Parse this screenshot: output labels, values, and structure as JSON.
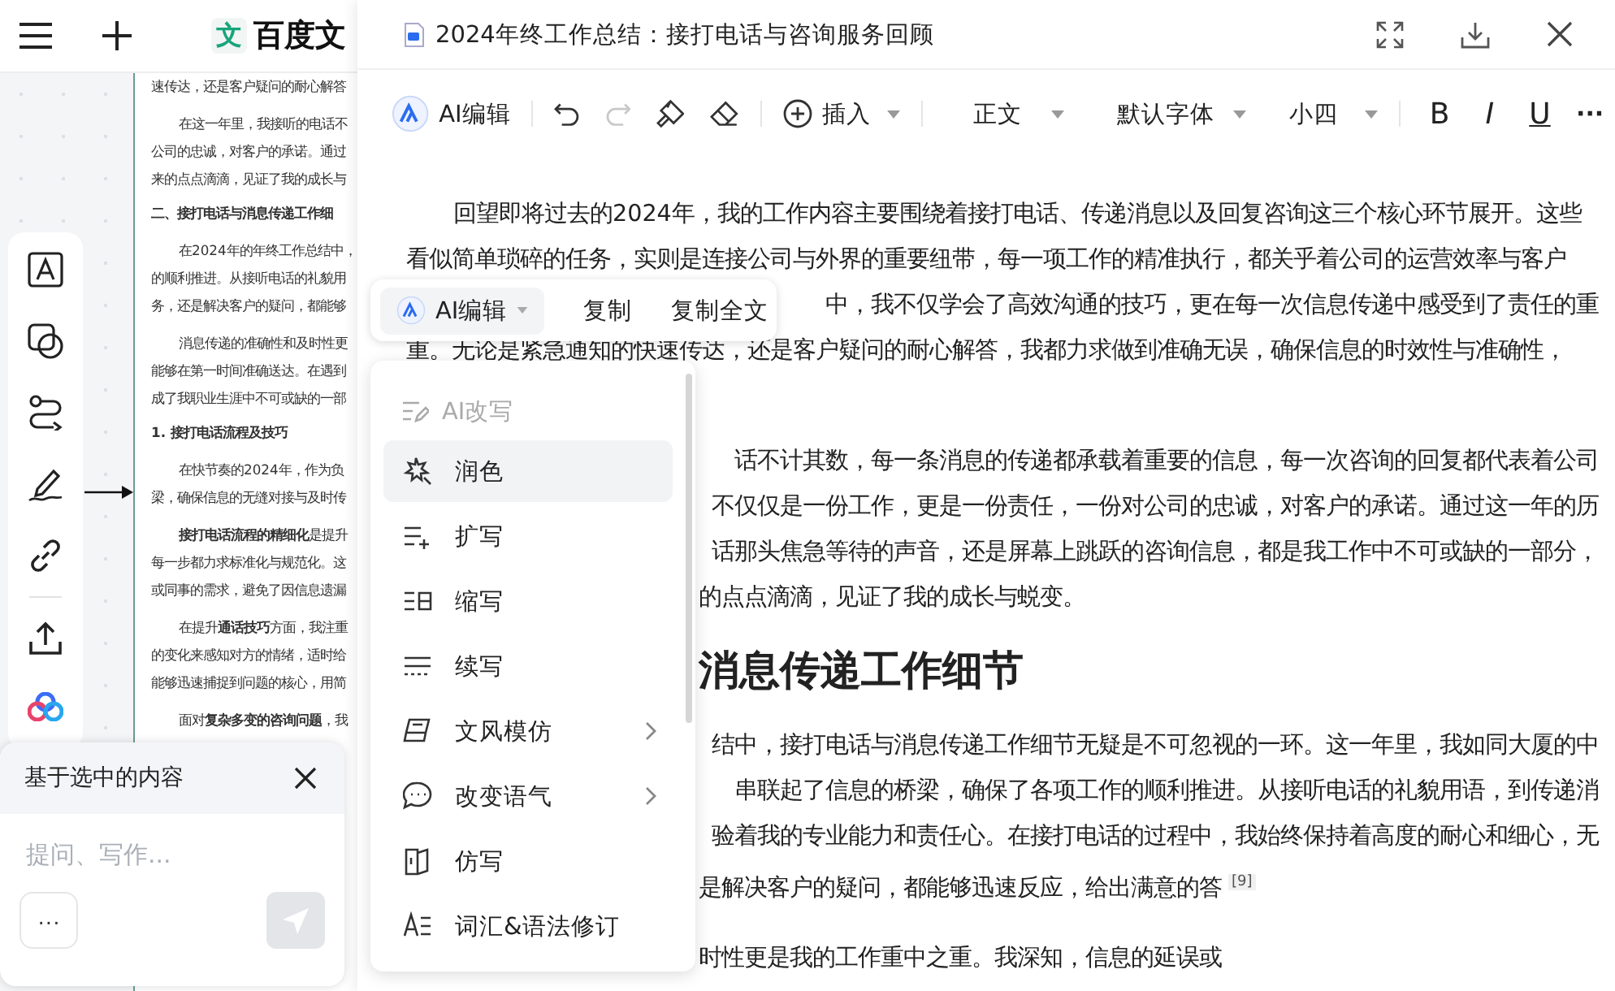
{
  "app_header": {
    "logo_mark": "文",
    "logo_text": "百度文"
  },
  "background_document": {
    "lines": [
      {
        "text": "速传达，还是客户疑问的耐心解答",
        "kind": "cont"
      },
      {
        "text": "在这一年里，我接听的电话不",
        "kind": "first"
      },
      {
        "text": "公司的忠诚，对客户的承诺。通过",
        "kind": "cont"
      },
      {
        "text": "来的点点滴滴，见证了我的成长与",
        "kind": "cont"
      },
      {
        "text": "二、接打电话与消息传递工作细",
        "kind": "heading"
      },
      {
        "text": "在2024年的年终工作总结中，",
        "kind": "first"
      },
      {
        "text": "的顺利推进。从接听电话的礼貌用",
        "kind": "cont"
      },
      {
        "text": "务，还是解决客户的疑问，都能够",
        "kind": "cont"
      },
      {
        "text": "消息传递的准确性和及时性更",
        "kind": "first"
      },
      {
        "text": "能够在第一时间准确送达。在遇到",
        "kind": "cont"
      },
      {
        "text": "成了我职业生涯中不可或缺的一部",
        "kind": "cont"
      },
      {
        "text": "1. 接打电话流程及技巧",
        "kind": "heading"
      },
      {
        "text": "在快节奏的2024年，作为负",
        "kind": "first"
      },
      {
        "text": "梁，确保信息的无缝对接与及时传",
        "kind": "cont"
      },
      {
        "text": "**接打电话流程的精细化**是提升",
        "kind": "first"
      },
      {
        "text": "每一步都力求标准化与规范化。这",
        "kind": "cont"
      },
      {
        "text": "或同事的需求，避免了因信息遗漏",
        "kind": "cont"
      },
      {
        "text": "在提升**通话技巧**方面，我注重",
        "kind": "first"
      },
      {
        "text": "的变化来感知对方的情绪，适时给",
        "kind": "cont"
      },
      {
        "text": "能够迅速捕捉到问题的核心，用简",
        "kind": "cont"
      },
      {
        "text": "面对**复杂多变的咨询问题**，我",
        "kind": "first"
      }
    ]
  },
  "ai_panel": {
    "title": "基于选中的内容",
    "placeholder": "提问、写作...",
    "more": "···"
  },
  "dialog": {
    "title": "2024年终工作总结：接打电话与咨询服务回顾"
  },
  "toolbar": {
    "ai_edit": "AI编辑",
    "redo_disabled": true,
    "insert": "插入",
    "style": "正文",
    "font": "默认字体",
    "size": "小四",
    "format": [
      "B",
      "I",
      "U"
    ],
    "more": "···"
  },
  "document": {
    "blocks": [
      {
        "kind": "paragraph",
        "lines": [
          {
            "text": "回望即将过去的2024年，我的工作内容主要围绕着接打电话、传递消息以及回复咨询这三个核心环节展开。这些",
            "kind": "indent"
          },
          {
            "text": "看似简单琐碎的任务，实则是连接公司与外界的重要纽带，每一项工作的精准执行，都关乎着公司的运营效率与客户",
            "kind": "full"
          },
          {
            "text": "中，我不仅学会了高效沟通的技巧，更在每一次信息传递中感受到了责任的重",
            "kind": "right"
          },
          {
            "text": "重。无论是紧急通知的快速传达，还是客户疑问的耐心解答，我都力求做到准确无误，确保信息的时效性与准确性，",
            "kind": "full"
          }
        ]
      },
      {
        "kind": "paragraph",
        "lines": [
          {
            "text": "话不计其数，每一条消息的传递都承载着重要的信息，每一次咨询的回复都代表着公司",
            "kind": "right"
          },
          {
            "text": "不仅仅是一份工作，更是一份责任，一份对公司的忠诚，对客户的承诺。通过这一年的历",
            "kind": "right"
          },
          {
            "text": "话那头焦急等待的声音，还是屏幕上跳跃的咨询信息，都是我工作中不可或缺的一部分，",
            "kind": "right"
          },
          {
            "text": "的点点滴滴，见证了我的成长与蜕变。",
            "kind": "after"
          }
        ]
      },
      {
        "kind": "heading",
        "text": "消息传递工作细节"
      },
      {
        "kind": "paragraph",
        "lines": [
          {
            "text": "结中，接打电话与消息传递工作细节无疑是不可忽视的一环。这一年里，我如同大厦的中",
            "kind": "right"
          },
          {
            "text": "串联起了信息的桥梁，确保了各项工作的顺利推进。从接听电话的礼貌用语，到传递消",
            "kind": "right"
          },
          {
            "text": "验着我的专业能力和责任心。在接打电话的过程中，我始终保持着高度的耐心和细心，无",
            "kind": "right"
          },
          {
            "text": "是解决客户的疑问，都能够迅速反应，给出满意的答$^{[9]}$",
            "kind": "after"
          }
        ]
      },
      {
        "kind": "paragraph",
        "lines": [
          {
            "text": "时性更是我的工作重中之重。我深知，信息的延误或",
            "kind": "after"
          }
        ]
      }
    ]
  },
  "selection_toolbar": {
    "ai_edit": "AI编辑",
    "actions": [
      "复制",
      "复制全文"
    ]
  },
  "menu": {
    "header": "AI改写",
    "header_disabled": true,
    "items": [
      {
        "label": "润色",
        "selected": true,
        "submenu": false
      },
      {
        "label": "扩写",
        "selected": false,
        "submenu": false
      },
      {
        "label": "缩写",
        "selected": false,
        "submenu": false
      },
      {
        "label": "续写",
        "selected": false,
        "submenu": false
      },
      {
        "label": "文风模仿",
        "selected": false,
        "submenu": true
      },
      {
        "label": "改变语气",
        "selected": false,
        "submenu": true
      },
      {
        "label": "仿写",
        "selected": false,
        "submenu": false
      },
      {
        "label": "词汇&语法修订",
        "selected": false,
        "submenu": false
      }
    ]
  }
}
